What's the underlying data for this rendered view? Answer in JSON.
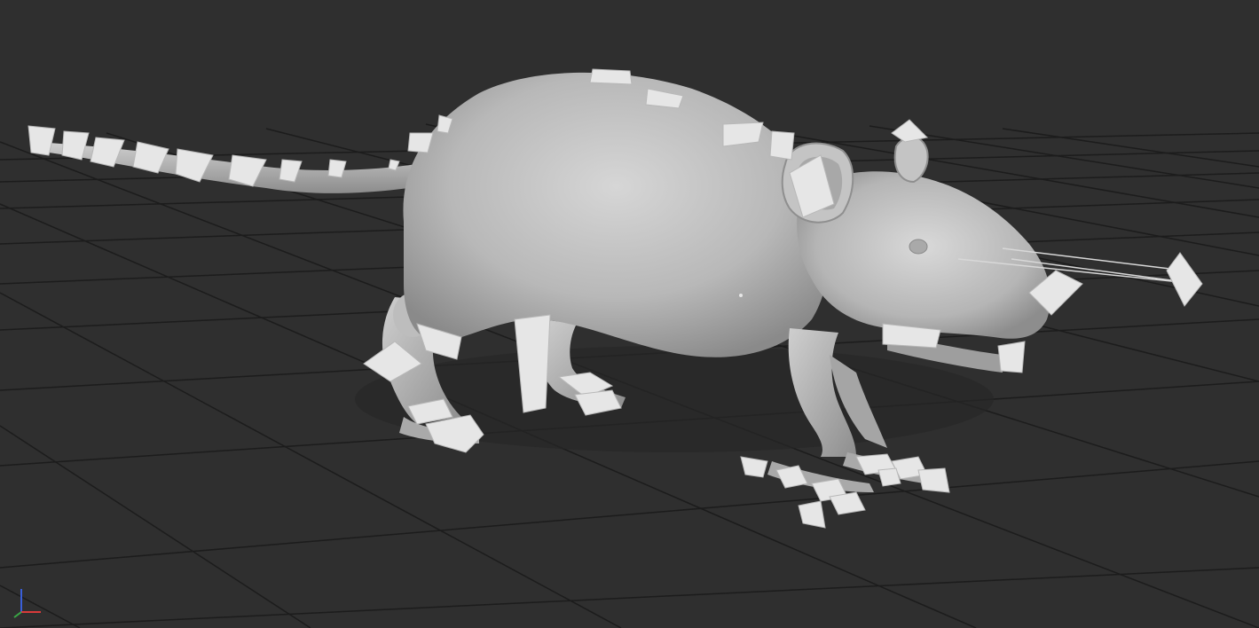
{
  "viewport": {
    "background_color": "#2f2f2f",
    "grid_line_color": "#1c1c1c",
    "model_color": "#bdbdbd",
    "bone_color": "#e6e6e6",
    "model_name_icon": "rat-mesh-icon"
  },
  "axis_gizmo": {
    "x_color": "#d93a3a",
    "y_color": "#3aa845",
    "z_color": "#3a5fd9"
  }
}
